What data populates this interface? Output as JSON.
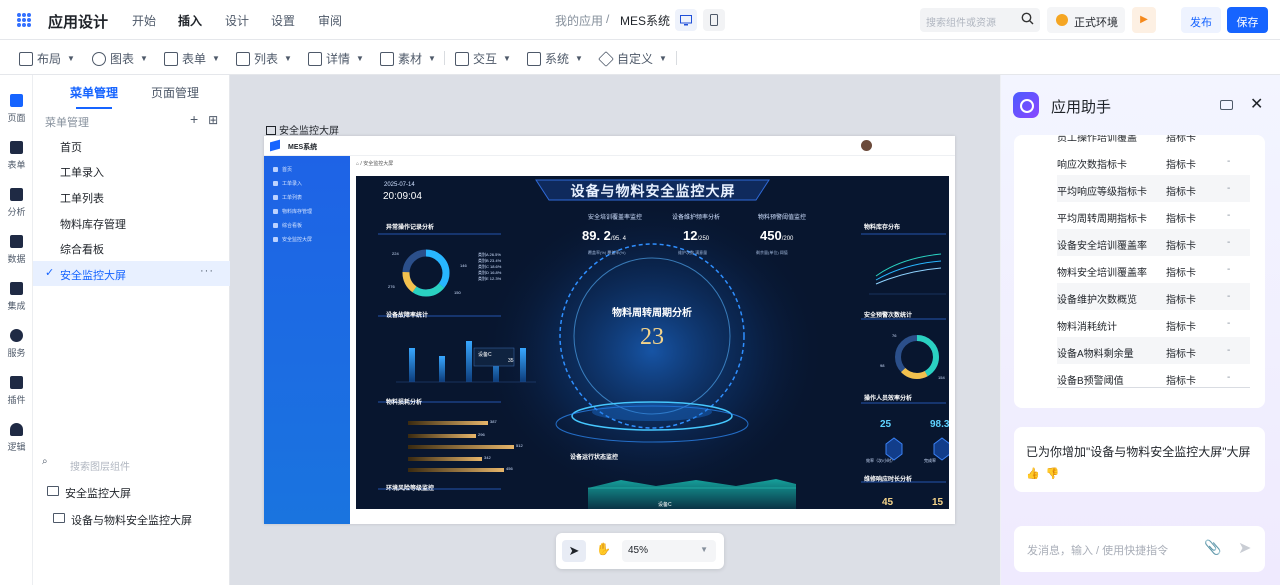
{
  "top": {
    "app_title": "应用设计",
    "nav_tabs": [
      "开始",
      "插入",
      "设计",
      "设置",
      "审阅"
    ],
    "active_tab": "插入",
    "breadcrumb_root": "我的应用",
    "breadcrumb_sep": "/",
    "breadcrumb_app": "MES系统",
    "search_placeholder": "搜索组件或资源",
    "env_label": "正式环境",
    "publish_label": "发布",
    "save_label": "保存",
    "accent": "#1664ff"
  },
  "toolbar": {
    "items": [
      "布局",
      "图表",
      "表单",
      "列表",
      "详情",
      "素材",
      "交互",
      "系统",
      "自定义"
    ]
  },
  "rail": {
    "items": [
      "页面",
      "表单",
      "分析",
      "数据",
      "集成",
      "服务",
      "插件",
      "逻辑"
    ]
  },
  "menu": {
    "tabs": [
      "菜单管理",
      "页面管理"
    ],
    "header": "菜单管理",
    "items": [
      "首页",
      "工单录入",
      "工单列表",
      "物料库存管理",
      "综合看板",
      "安全监控大屏"
    ],
    "active_item": "安全监控大屏",
    "layer_search_placeholder": "搜索图层组件",
    "layers": [
      "安全监控大屏",
      "设备与物料安全监控大屏"
    ]
  },
  "canvas": {
    "page_label": "安全监控大屏",
    "zoom": "45%",
    "preview": {
      "brand": "MES系统",
      "side_items": [
        "首页",
        "工单录入",
        "工单列表",
        "物料库存管理",
        "综合看板",
        "安全监控大屏"
      ],
      "breadcrumb": "安全监控大屏",
      "date": "2025-07-14",
      "time": "20:09:04",
      "title": "设备与物料安全监控大屏",
      "kpi_titles": [
        "安全培训覆盖率监控",
        "设备维护频率分析",
        "物料预警阈值监控"
      ],
      "kpi_values": [
        "89. 2",
        "12",
        "450"
      ],
      "kpi_suffix": [
        "/95. 4",
        "/250",
        "/200"
      ],
      "kpi_sub": [
        "覆盖率(%)  覆盖率(%)",
        "维护次数  满意量",
        "剩余量(单位)  阈值"
      ],
      "center_title": "物料周转周期分析",
      "center_value": "23",
      "panels_left": [
        "异常操作记录分析",
        "设备故障率统计",
        "物料损耗分析",
        "环境风险等级监控"
      ],
      "panels_right": [
        "物料库存分布",
        "安全预警次数统计",
        "操作人员效率分析",
        "维修响应时长分析"
      ],
      "bottom_title": "设备运行状态监控",
      "donut_labels": [
        "224",
        "146",
        "276",
        "150"
      ],
      "donut_legend": [
        "类别A 26.5%",
        "类别B 23.4%",
        "类别C 18.6%",
        "类别D 16.8%",
        "类别E 12.3%"
      ],
      "loss_values": [
        "387",
        "296",
        "512",
        "342",
        "456"
      ],
      "right_donut_labels": [
        "76",
        "98",
        "154"
      ],
      "efficiency_values": [
        "25",
        "98.3"
      ],
      "efficiency_labels": [
        "效率（次/小时）",
        "完成率"
      ],
      "response_values": [
        "45",
        "15"
      ],
      "tooltip_label": "设备C",
      "tooltip_value": "35",
      "bottom_tag": "设备C"
    }
  },
  "assistant": {
    "title": "应用助手",
    "rows": [
      {
        "name": "员工操作培训覆盖",
        "type": "指标卡",
        "val": "-"
      },
      {
        "name": "响应次数指标卡",
        "type": "指标卡",
        "val": "-"
      },
      {
        "name": "平均响应等级指标卡",
        "type": "指标卡",
        "val": "-"
      },
      {
        "name": "平均周转周期指标卡",
        "type": "指标卡",
        "val": "-"
      },
      {
        "name": "设备安全培训覆盖率",
        "type": "指标卡",
        "val": "-"
      },
      {
        "name": "物料安全培训覆盖率",
        "type": "指标卡",
        "val": "-"
      },
      {
        "name": "设备维护次数概览",
        "type": "指标卡",
        "val": "-"
      },
      {
        "name": "物料消耗统计",
        "type": "指标卡",
        "val": "-"
      },
      {
        "name": "设备A物料剩余量",
        "type": "指标卡",
        "val": "-"
      },
      {
        "name": "设备B预警阈值",
        "type": "指标卡",
        "val": "-"
      }
    ],
    "message": "已为你增加\"设备与物料安全监控大屏\"大屏",
    "input_placeholder": "发消息，输入 / 使用快捷指令"
  }
}
